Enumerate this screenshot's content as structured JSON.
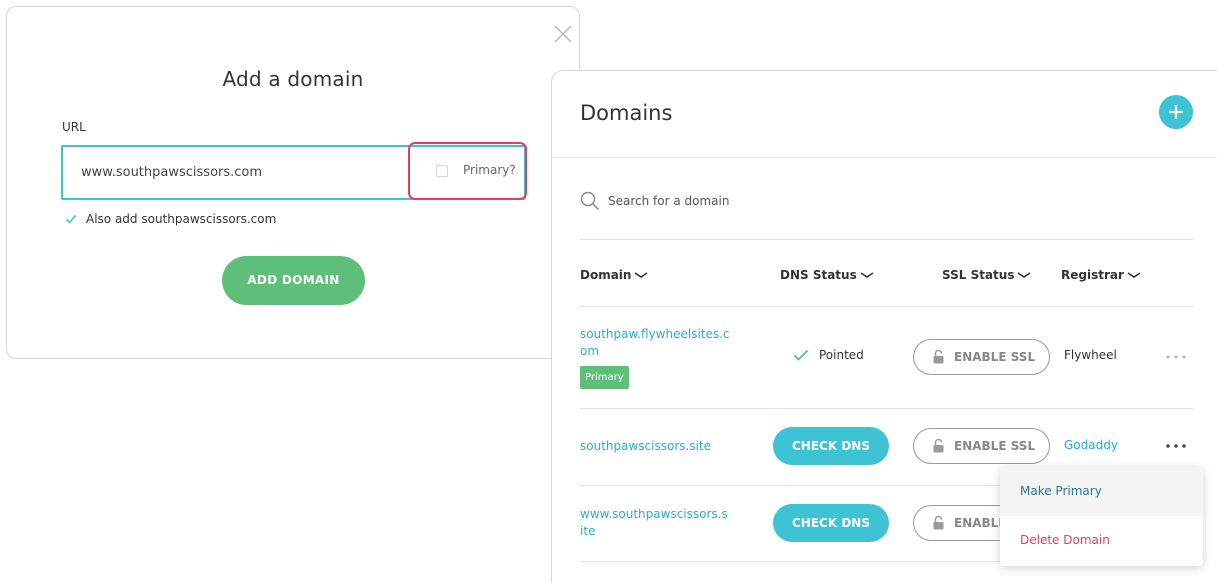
{
  "add_modal": {
    "title": "Add a domain",
    "url_label": "URL",
    "url_value": "www.southpawscissors.com",
    "primary_label": "Primary?",
    "primary_checked": false,
    "also_add_label": "Also add southpawscissors.com",
    "also_add_checked": true,
    "add_button": "ADD DOMAIN"
  },
  "domains_panel": {
    "title": "Domains",
    "search_placeholder": "Search for a domain",
    "columns": [
      "Domain",
      "DNS Status",
      "SSL Status",
      "Registrar"
    ],
    "rows": [
      {
        "domain_line1": "southpaw.flywheelsites.c",
        "domain_line2": "om",
        "badge": "Primary",
        "dns_status": "Pointed",
        "ssl_button": "ENABLE SSL",
        "registrar": "Flywheel"
      },
      {
        "domain_line1": "southpawscissors.site",
        "dns_button": "CHECK DNS",
        "ssl_button": "ENABLE SSL",
        "registrar": "Godaddy"
      },
      {
        "domain_line1": "www.southpawscissors.s",
        "domain_line2": "ite",
        "dns_button": "CHECK DNS",
        "ssl_button": "ENABLE SSL"
      }
    ]
  },
  "row_menu": {
    "items": [
      "Make Primary",
      "Delete Domain"
    ]
  },
  "colors": {
    "accent": "#3ec3d5",
    "green": "#5ebf7b",
    "highlight_red": "#e0415a",
    "link": "#26b0c6"
  }
}
